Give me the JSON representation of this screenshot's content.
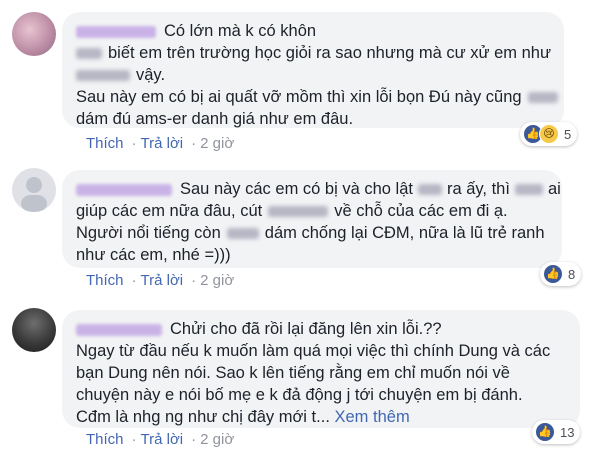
{
  "colors": {
    "bubble": "#f2f3f5",
    "link": "#4267b2",
    "muted": "#90949c",
    "like": "#3b5998"
  },
  "comments": [
    {
      "lines": [
        [
          "Có lớn mà k có khôn"
        ],
        [
          "biết em trên trường học giỏi ra sao nhưng mà cư xử em như"
        ],
        [
          "vậy."
        ],
        [
          "Sau này em có bị ai quất vỡ mồm thì xin lỗi bọn Đú này cũng"
        ],
        [
          "dám đú ams-er danh giá như em đâu."
        ]
      ],
      "actions": {
        "like": "Thích",
        "reply": "Trả lời",
        "sep": "·",
        "time": "2 giờ"
      },
      "reactions": {
        "icons": [
          "like-icon",
          "sad-icon"
        ],
        "count": "5"
      }
    },
    {
      "lines": [
        [
          "Sau này các em có bị và cho lật",
          "ra ấy, thì",
          "ai"
        ],
        [
          "giúp các em nữa đâu, cút",
          "về chỗ của các em đi ạ."
        ],
        [
          "Người nổi tiếng còn",
          "dám chống lại CĐM, nữa là lũ trẻ ranh"
        ],
        [
          "như các em, nhé =)))"
        ]
      ],
      "actions": {
        "like": "Thích",
        "reply": "Trả lời",
        "sep": "·",
        "time": "2 giờ"
      },
      "reactions": {
        "icons": [
          "like-icon"
        ],
        "count": "8"
      }
    },
    {
      "lines": [
        [
          "Chửi cho đã rồi lại đăng lên xin lỗi.??"
        ],
        [
          "Ngay từ đầu nếu k muốn làm quá mọi việc thì chính Dung và các"
        ],
        [
          "bạn Dung nên nói. Sao k lên tiếng rằng em chỉ muốn nói về"
        ],
        [
          "chuyện này e nói bố mẹ e k đả động j tới chuyện em bị đánh."
        ],
        [
          "Cđm là nhg ng như chị đây mới t..."
        ]
      ],
      "see_more": "Xem thêm",
      "actions": {
        "like": "Thích",
        "reply": "Trả lời",
        "sep": "·",
        "time": "2 giờ"
      },
      "reactions": {
        "icons": [
          "like-icon"
        ],
        "count": "13"
      }
    }
  ]
}
